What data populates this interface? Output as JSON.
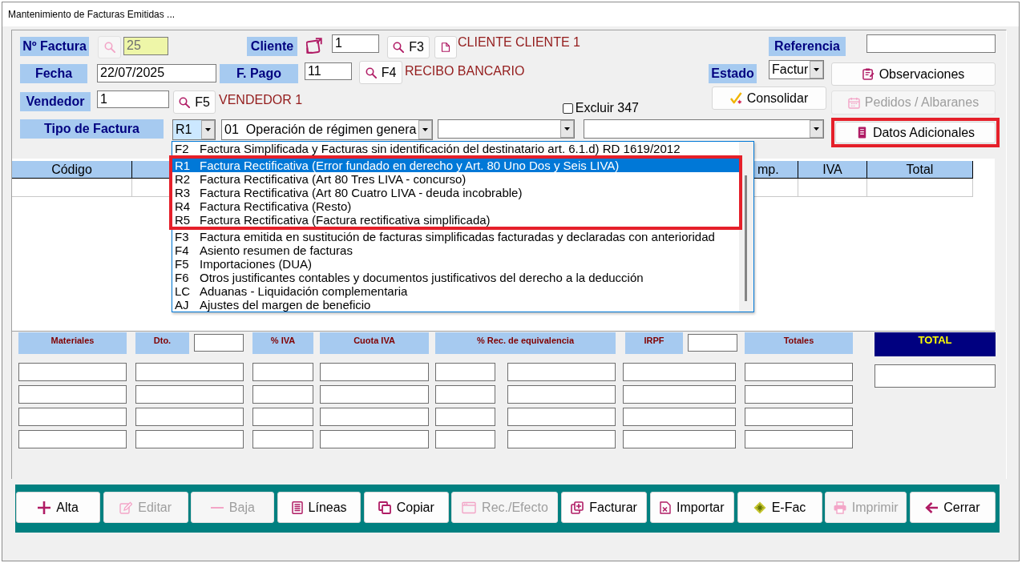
{
  "window": {
    "title": "Mantenimiento de Facturas Emitidas ..."
  },
  "form": {
    "invoice_number": {
      "label": "Nº Factura",
      "value": "25",
      "readonly": true,
      "search_disabled": true
    },
    "client": {
      "label": "Cliente",
      "value": "1",
      "lookup_key": "F3",
      "name": "CLIENTE CLIENTE 1"
    },
    "reference": {
      "label": "Referencia"
    },
    "date": {
      "label": "Fecha",
      "value": "22/07/2025"
    },
    "payment": {
      "label": "F. Pago",
      "value": "11",
      "lookup_key": "F4",
      "name": "RECIBO BANCARIO"
    },
    "status": {
      "label": "Estado",
      "value": "Factur"
    },
    "seller": {
      "label": "Vendedor",
      "value": "1",
      "lookup_key": "F5",
      "name": "VENDEDOR 1"
    },
    "exclude_347": {
      "label": "Excluir 347",
      "checked": false
    },
    "invoice_type": {
      "label": "Tipo de Factura",
      "type_select": {
        "value": "R1",
        "focused": true,
        "expanded": true
      },
      "regime_select": {
        "code": "01",
        "value": "Operación de régimen genera",
        "focused": false
      },
      "option_groups": [
        {
          "highlighted": false,
          "options": [
            {
              "code": "F2",
              "text": "Factura Simplificada y Facturas sin identificación del destinatario art. 6.1.d) RD 1619/2012",
              "selected": false
            }
          ]
        },
        {
          "highlighted": true,
          "options": [
            {
              "code": "R1",
              "text": "Factura Rectificativa (Error fundado en derecho y Art. 80 Uno Dos y Seis LIVA)",
              "selected": true
            },
            {
              "code": "R2",
              "text": "Factura Rectificativa (Art 80 Tres LIVA - concurso)",
              "selected": false
            },
            {
              "code": "R3",
              "text": "Factura Rectificativa (Art 80 Cuatro LIVA - deuda incobrable)",
              "selected": false
            },
            {
              "code": "R4",
              "text": "Factura Rectificativa (Resto)",
              "selected": false
            },
            {
              "code": "R5",
              "text": "Factura Rectificativa (Factura rectificativa simplificada)",
              "selected": false
            }
          ]
        },
        {
          "highlighted": false,
          "options": [
            {
              "code": "F3",
              "text": "Factura emitida en sustitución de facturas simplificadas facturadas y declaradas con anterioridad",
              "selected": false
            },
            {
              "code": "F4",
              "text": "Asiento resumen de facturas",
              "selected": false
            },
            {
              "code": "F5",
              "text": "Importaciones (DUA)",
              "selected": false
            },
            {
              "code": "F6",
              "text": "Otros justificantes contables y documentos justificativos del derecho a la deducción",
              "selected": false
            },
            {
              "code": "LC",
              "text": "Aduanas - Liquidación complementaria",
              "selected": false
            },
            {
              "code": "AJ",
              "text": "Ajustes del margen de beneficio",
              "selected": false
            }
          ]
        }
      ]
    },
    "side_buttons": [
      {
        "label": "Observaciones",
        "disabled": false,
        "highlighted": false
      },
      {
        "label": "Consolidar",
        "disabled": false,
        "highlighted": false
      },
      {
        "label": "Pedidos / Albaranes",
        "disabled": true,
        "highlighted": false
      },
      {
        "label": "Datos Adicionales",
        "disabled": false,
        "highlighted": true
      }
    ]
  },
  "lines_table": {
    "columns": [
      {
        "label": "Código"
      },
      {
        "label": "mp."
      },
      {
        "label": "IVA"
      },
      {
        "label": "Total"
      }
    ]
  },
  "totals": {
    "headers": [
      {
        "label": "Materiales",
        "kind": "plain"
      },
      {
        "label": "Dto.",
        "kind": "with_input"
      },
      {
        "label": "% IVA",
        "kind": "plain"
      },
      {
        "label": "Cuota IVA",
        "kind": "plain"
      },
      {
        "label": "% Rec. de equivalencia",
        "kind": "plain"
      },
      {
        "label": "IRPF",
        "kind": "with_input"
      },
      {
        "label": "Totales",
        "kind": "plain"
      }
    ],
    "total_label": "TOTAL"
  },
  "toolbar": [
    {
      "label": "Alta",
      "disabled": false
    },
    {
      "label": "Editar",
      "disabled": true
    },
    {
      "label": "Baja",
      "disabled": true
    },
    {
      "label": "Líneas",
      "disabled": false
    },
    {
      "label": "Copiar",
      "disabled": false
    },
    {
      "label": "Rec./Efecto",
      "disabled": true
    },
    {
      "label": "Facturar",
      "disabled": false
    },
    {
      "label": "Importar",
      "disabled": false
    },
    {
      "label": "E-Fac",
      "disabled": false
    },
    {
      "label": "Imprimir",
      "disabled": true
    },
    {
      "label": "Cerrar",
      "disabled": false
    }
  ]
}
